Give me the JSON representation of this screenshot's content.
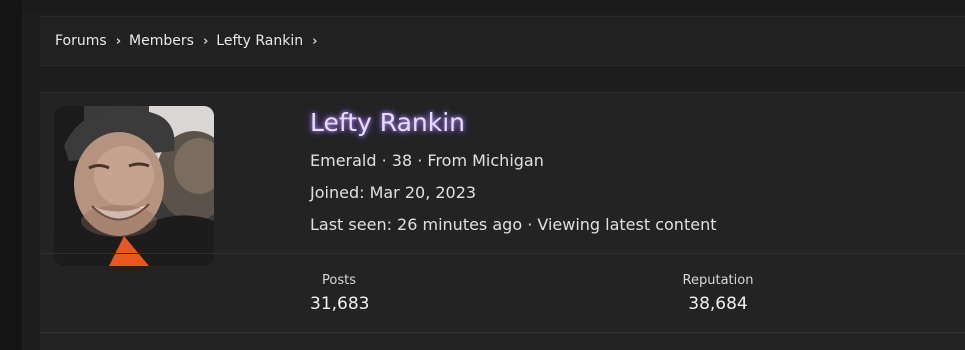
{
  "breadcrumb": {
    "items": [
      "Forums",
      "Members",
      "Lefty Rankin"
    ]
  },
  "profile": {
    "username": "Lefty Rankin",
    "meta_line": "Emerald · 38 · From Michigan",
    "joined": "Joined: Mar 20, 2023",
    "last_seen": "Last seen: 26 minutes ago · Viewing latest content"
  },
  "stats": [
    {
      "label": "Posts",
      "value": "31,683"
    },
    {
      "label": "Reputation",
      "value": "38,684"
    }
  ],
  "colors": {
    "background": "#1d1d1d",
    "card": "#232323",
    "username_glow": "#a98aff"
  }
}
